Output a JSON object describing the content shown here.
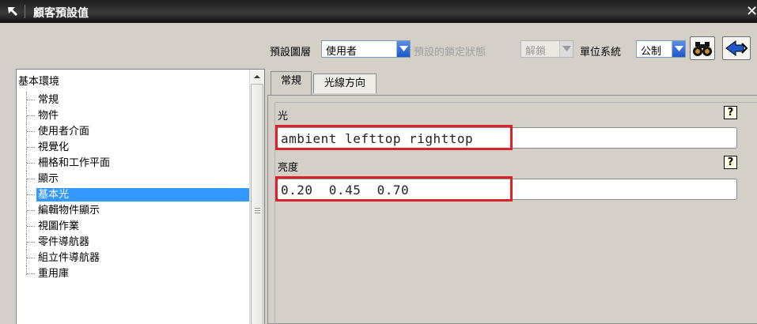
{
  "window": {
    "title": "顧客預設值",
    "close_glyph": "✕"
  },
  "toolbar": {
    "default_level_label": "預設圖層",
    "default_level_value": "使用者",
    "lock_state_label": "預設的鎖定狀態",
    "lock_state_value": "解鎖",
    "unit_system_label": "單位系統",
    "unit_system_value": "公制",
    "find_icon": "binoculars-icon",
    "back_icon": "arrow-back-icon"
  },
  "tree": {
    "root": "基本環境",
    "items": [
      {
        "label": "常規"
      },
      {
        "label": "物件"
      },
      {
        "label": "使用者介面"
      },
      {
        "label": "視覺化"
      },
      {
        "label": "柵格和工作平面"
      },
      {
        "label": "顯示"
      },
      {
        "label": "基本光",
        "selected": true
      },
      {
        "label": "編輯物件顯示"
      },
      {
        "label": "視圖作業"
      },
      {
        "label": "零件導航器"
      },
      {
        "label": "組立件導航器"
      },
      {
        "label": "重用庫"
      }
    ]
  },
  "tabs": [
    {
      "label": "常規",
      "active": true
    },
    {
      "label": "光線方向",
      "active": false
    }
  ],
  "fields": {
    "light": {
      "label": "光",
      "value": "ambient lefttop righttop",
      "help": "?"
    },
    "brightness": {
      "label": "亮度",
      "value": "0.20  0.45  0.70",
      "help": "?"
    }
  },
  "colors": {
    "highlight": "#d8232a",
    "selection": "#3399ff",
    "combo_button": "#1f56c9"
  }
}
